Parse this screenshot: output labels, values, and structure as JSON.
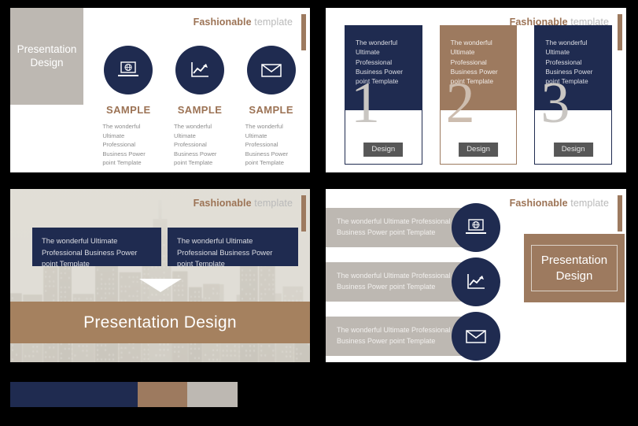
{
  "brand": {
    "bold": "Fashionable",
    "light": "template"
  },
  "colors": {
    "navy": "#1f2b50",
    "tan": "#9d7a5f",
    "grey": "#bdb8b2",
    "accent_text": "#9c7355",
    "button_grey": "#575757"
  },
  "slide1": {
    "title_box": "Presentation\nDesign",
    "items": [
      {
        "icon": "laptop-globe-icon",
        "label": "SAMPLE",
        "desc": "The wonderful Ultimate Professional Business Power point Template"
      },
      {
        "icon": "growth-chart-icon",
        "label": "SAMPLE",
        "desc": "The wonderful Ultimate Professional Business Power point Template"
      },
      {
        "icon": "envelope-icon",
        "label": "SAMPLE",
        "desc": "The wonderful Ultimate Professional Business Power point Template"
      }
    ]
  },
  "slide2": {
    "cards": [
      {
        "text": "The wonderful Ultimate Professional Business Power point Template",
        "number": "1",
        "button": "Design",
        "color": "navy"
      },
      {
        "text": "The wonderful Ultimate Professional Business Power point Template",
        "number": "2",
        "button": "Design",
        "color": "tan"
      },
      {
        "text": "The wonderful Ultimate Professional Business Power point Template",
        "number": "3",
        "button": "Design",
        "color": "navy"
      }
    ]
  },
  "slide3": {
    "box1": "The wonderful Ultimate Professional Business Power point Template",
    "box2": "The wonderful Ultimate Professional Business Power point Template",
    "band_title": "Presentation Design"
  },
  "slide4": {
    "rows": [
      {
        "text": "The wonderful Ultimate Professional Business Power point Template",
        "icon": "laptop-globe-icon"
      },
      {
        "text": "The wonderful Ultimate Professional Business Power point Template",
        "icon": "growth-chart-icon"
      },
      {
        "text": "The wonderful Ultimate Professional Business Power point Template",
        "icon": "envelope-icon"
      }
    ],
    "panel_title": "Presentation\nDesign"
  },
  "swatches": [
    {
      "name": "navy-swatch",
      "color": "#1f2b50"
    },
    {
      "name": "tan-swatch",
      "color": "#9d7a5f"
    },
    {
      "name": "grey-swatch",
      "color": "#bdb8b2"
    }
  ]
}
